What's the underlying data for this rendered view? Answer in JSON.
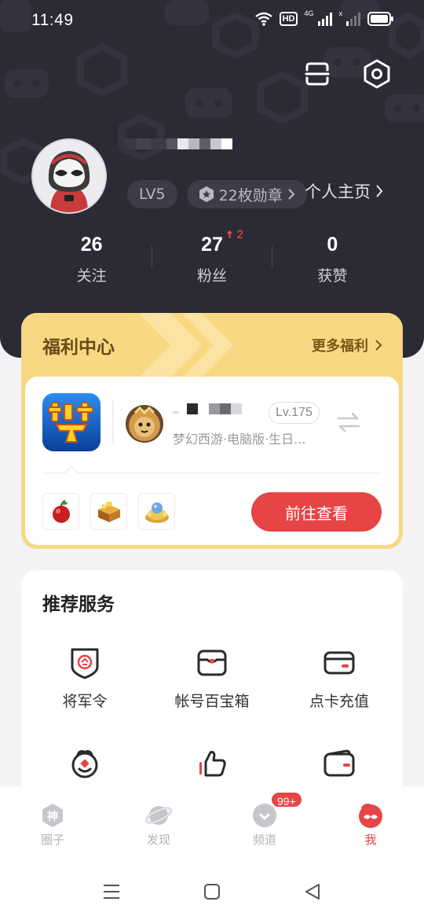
{
  "status_bar": {
    "time": "11:49",
    "hd_label": "HD",
    "sim1_label": "4G",
    "sim2_label": "x"
  },
  "profile": {
    "level": "LV5",
    "medals": "22枚勋章",
    "homepage_link": "个人主页",
    "stats": [
      {
        "value": "26",
        "label": "关注"
      },
      {
        "value": "27",
        "label": "粉丝",
        "delta": "2"
      },
      {
        "value": "0",
        "label": "获赞"
      }
    ]
  },
  "welfare": {
    "title": "福利中心",
    "more": "更多福利",
    "role_level": "Lv.175",
    "role_desc": "梦幻西游·电脑版·生日...",
    "action_button": "前往查看"
  },
  "services": {
    "title": "推荐服务",
    "items": [
      {
        "label": "将军令",
        "icon": "general-token-icon"
      },
      {
        "label": "帐号百宝箱",
        "icon": "treasure-box-icon"
      },
      {
        "label": "点卡充值",
        "icon": "card-recharge-icon"
      },
      {
        "label": "",
        "icon": "face-service-icon"
      },
      {
        "label": "",
        "icon": "thumbs-up-icon"
      },
      {
        "label": "",
        "icon": "wallet-icon"
      }
    ]
  },
  "tabbar": {
    "tabs": [
      {
        "label": "圈子",
        "icon": "circle-icon"
      },
      {
        "label": "发现",
        "icon": "planet-icon"
      },
      {
        "label": "频道",
        "icon": "channel-icon"
      },
      {
        "label": "我",
        "icon": "me-mask-icon"
      }
    ],
    "channel_badge": "99+"
  },
  "colors": {
    "accent": "#e64545",
    "header_bg": "#2b2b36",
    "welfare_bg": "#f9d884"
  }
}
